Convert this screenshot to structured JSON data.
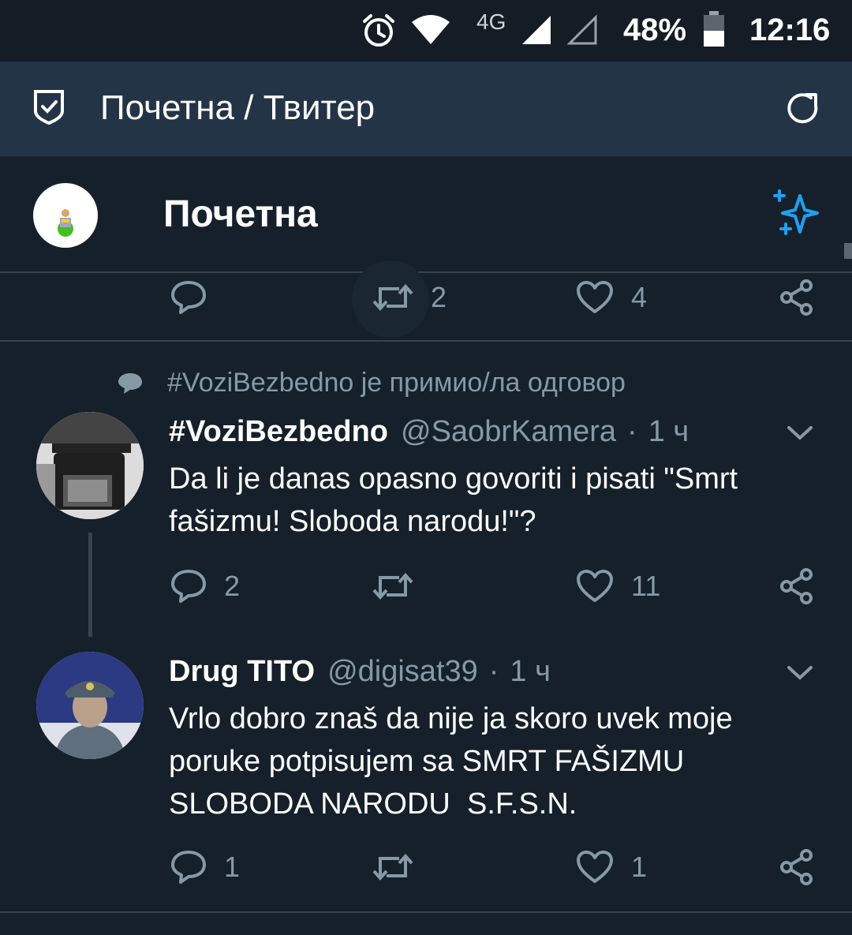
{
  "status_bar": {
    "network": "4G",
    "battery": "48%",
    "time": "12:16"
  },
  "app_bar": {
    "title": "Почетна / Твитер"
  },
  "header": {
    "title": "Почетна"
  },
  "prev_tweet_actions": {
    "reply_count": "",
    "retweet_count": "2",
    "like_count": "4"
  },
  "context": {
    "text": "#VoziBezbedno је примио/ла одговор"
  },
  "tweets": [
    {
      "name": "#VoziBezbedno",
      "handle": "@SaobrKamera",
      "dot": "·",
      "time": "1 ч",
      "text": "Da li je danas opasno govoriti i pisati \"Smrt fašizmu! Sloboda narodu!\"?",
      "reply_count": "2",
      "retweet_count": "",
      "like_count": "11"
    },
    {
      "name": "Drug TITO",
      "handle": "@digisat39",
      "dot": "·",
      "time": "1 ч",
      "text": "Vrlo dobro znaš da nije ja skoro uvek moje poruke potpisujem sa SMRT FAŠIZMU SLOBODA NARODU  S.F.S.N.",
      "reply_count": "1",
      "retweet_count": "",
      "like_count": "1"
    }
  ],
  "colors": {
    "background": "#15202b",
    "app_bar": "#243447",
    "secondary_text": "#8899a6",
    "accent": "#1da1f2",
    "divider": "#38444d"
  },
  "icons": [
    "alarm-icon",
    "wifi-icon",
    "signal-icon",
    "battery-icon",
    "shield-check-icon",
    "refresh-icon",
    "sparkle-icon",
    "reply-icon",
    "retweet-icon",
    "like-icon",
    "share-icon",
    "chevron-down-icon",
    "speech-bubble-icon"
  ]
}
